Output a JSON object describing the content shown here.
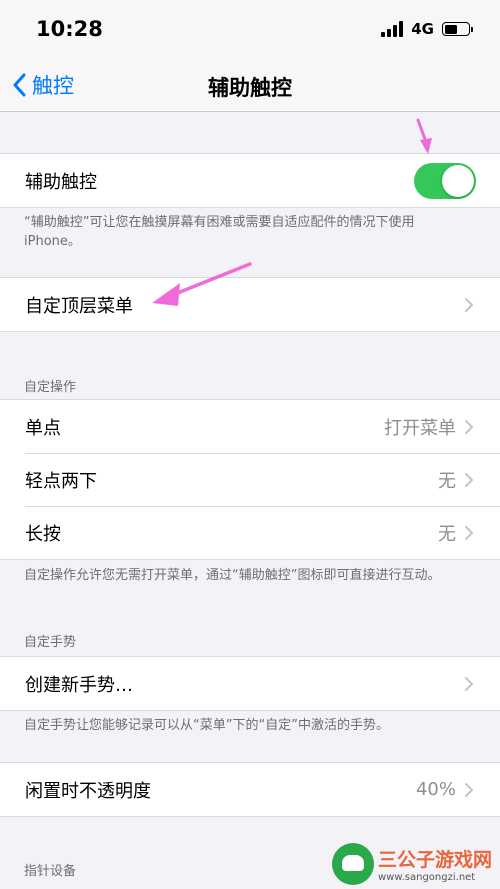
{
  "status": {
    "time": "10:28",
    "network": "4G"
  },
  "nav": {
    "back_label": "触控",
    "title": "辅助触控"
  },
  "assistive_touch": {
    "label": "辅助触控",
    "footer": "“辅助触控”可让您在触摸屏幕有困难或需要自适应配件的情况下使用iPhone。"
  },
  "top_menu": {
    "label": "自定顶层菜单"
  },
  "custom_actions": {
    "header": "自定操作",
    "rows": [
      {
        "label": "单点",
        "value": "打开菜单"
      },
      {
        "label": "轻点两下",
        "value": "无"
      },
      {
        "label": "长按",
        "value": "无"
      }
    ],
    "footer": "自定操作允许您无需打开菜单，通过“辅助触控”图标即可直接进行互动。"
  },
  "custom_gestures": {
    "header": "自定手势",
    "create_label": "创建新手势…",
    "footer": "自定手势让您能够记录可以从“菜单”下的“自定”中激活的手势。"
  },
  "idle_opacity": {
    "label": "闲置时不透明度",
    "value": "40%"
  },
  "pointer_devices": {
    "header": "指针设备"
  },
  "watermark": {
    "title": "三公子游戏网",
    "url": "www.sangongzi.net"
  },
  "colors": {
    "accent": "#007aff",
    "toggle_on": "#34c759",
    "arrow": "#f06bd8"
  }
}
